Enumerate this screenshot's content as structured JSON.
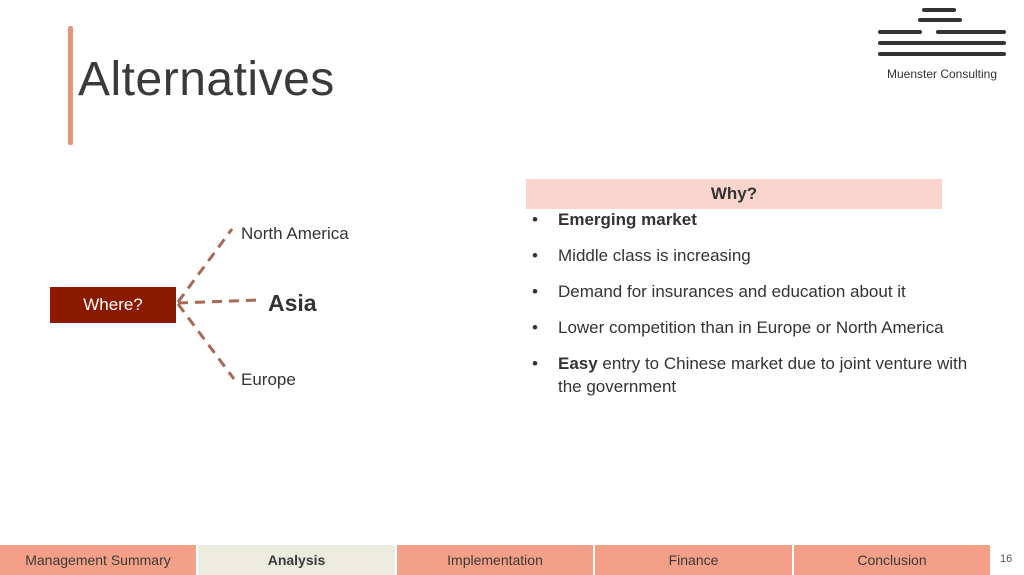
{
  "slide": {
    "title": "Alternatives",
    "page_number": "16"
  },
  "logo": {
    "text": "Muenster Consulting"
  },
  "diagram": {
    "where_label": "Where?",
    "regions": [
      "North America",
      "Asia",
      "Europe"
    ]
  },
  "why": {
    "header": "Why?",
    "items": [
      {
        "bold": "Emerging market",
        "text": ""
      },
      {
        "bold": "",
        "text": "Middle class is increasing"
      },
      {
        "bold": "",
        "text": "Demand for insurances and education about it"
      },
      {
        "bold": "",
        "text": "Lower competition than in Europe or North America"
      },
      {
        "bold": "Easy",
        "text": " entry to Chinese market due to joint venture with the government"
      }
    ]
  },
  "nav": {
    "tabs": [
      "Management Summary",
      "Analysis",
      "Implementation",
      "Finance",
      "Conclusion"
    ],
    "active_index": 1
  },
  "colors": {
    "accent": "#e9937a",
    "dark_red": "#8b1a00",
    "tab": "#f4a088",
    "tab_active": "#ecebe0",
    "header_fill": "#f9d5cd"
  }
}
